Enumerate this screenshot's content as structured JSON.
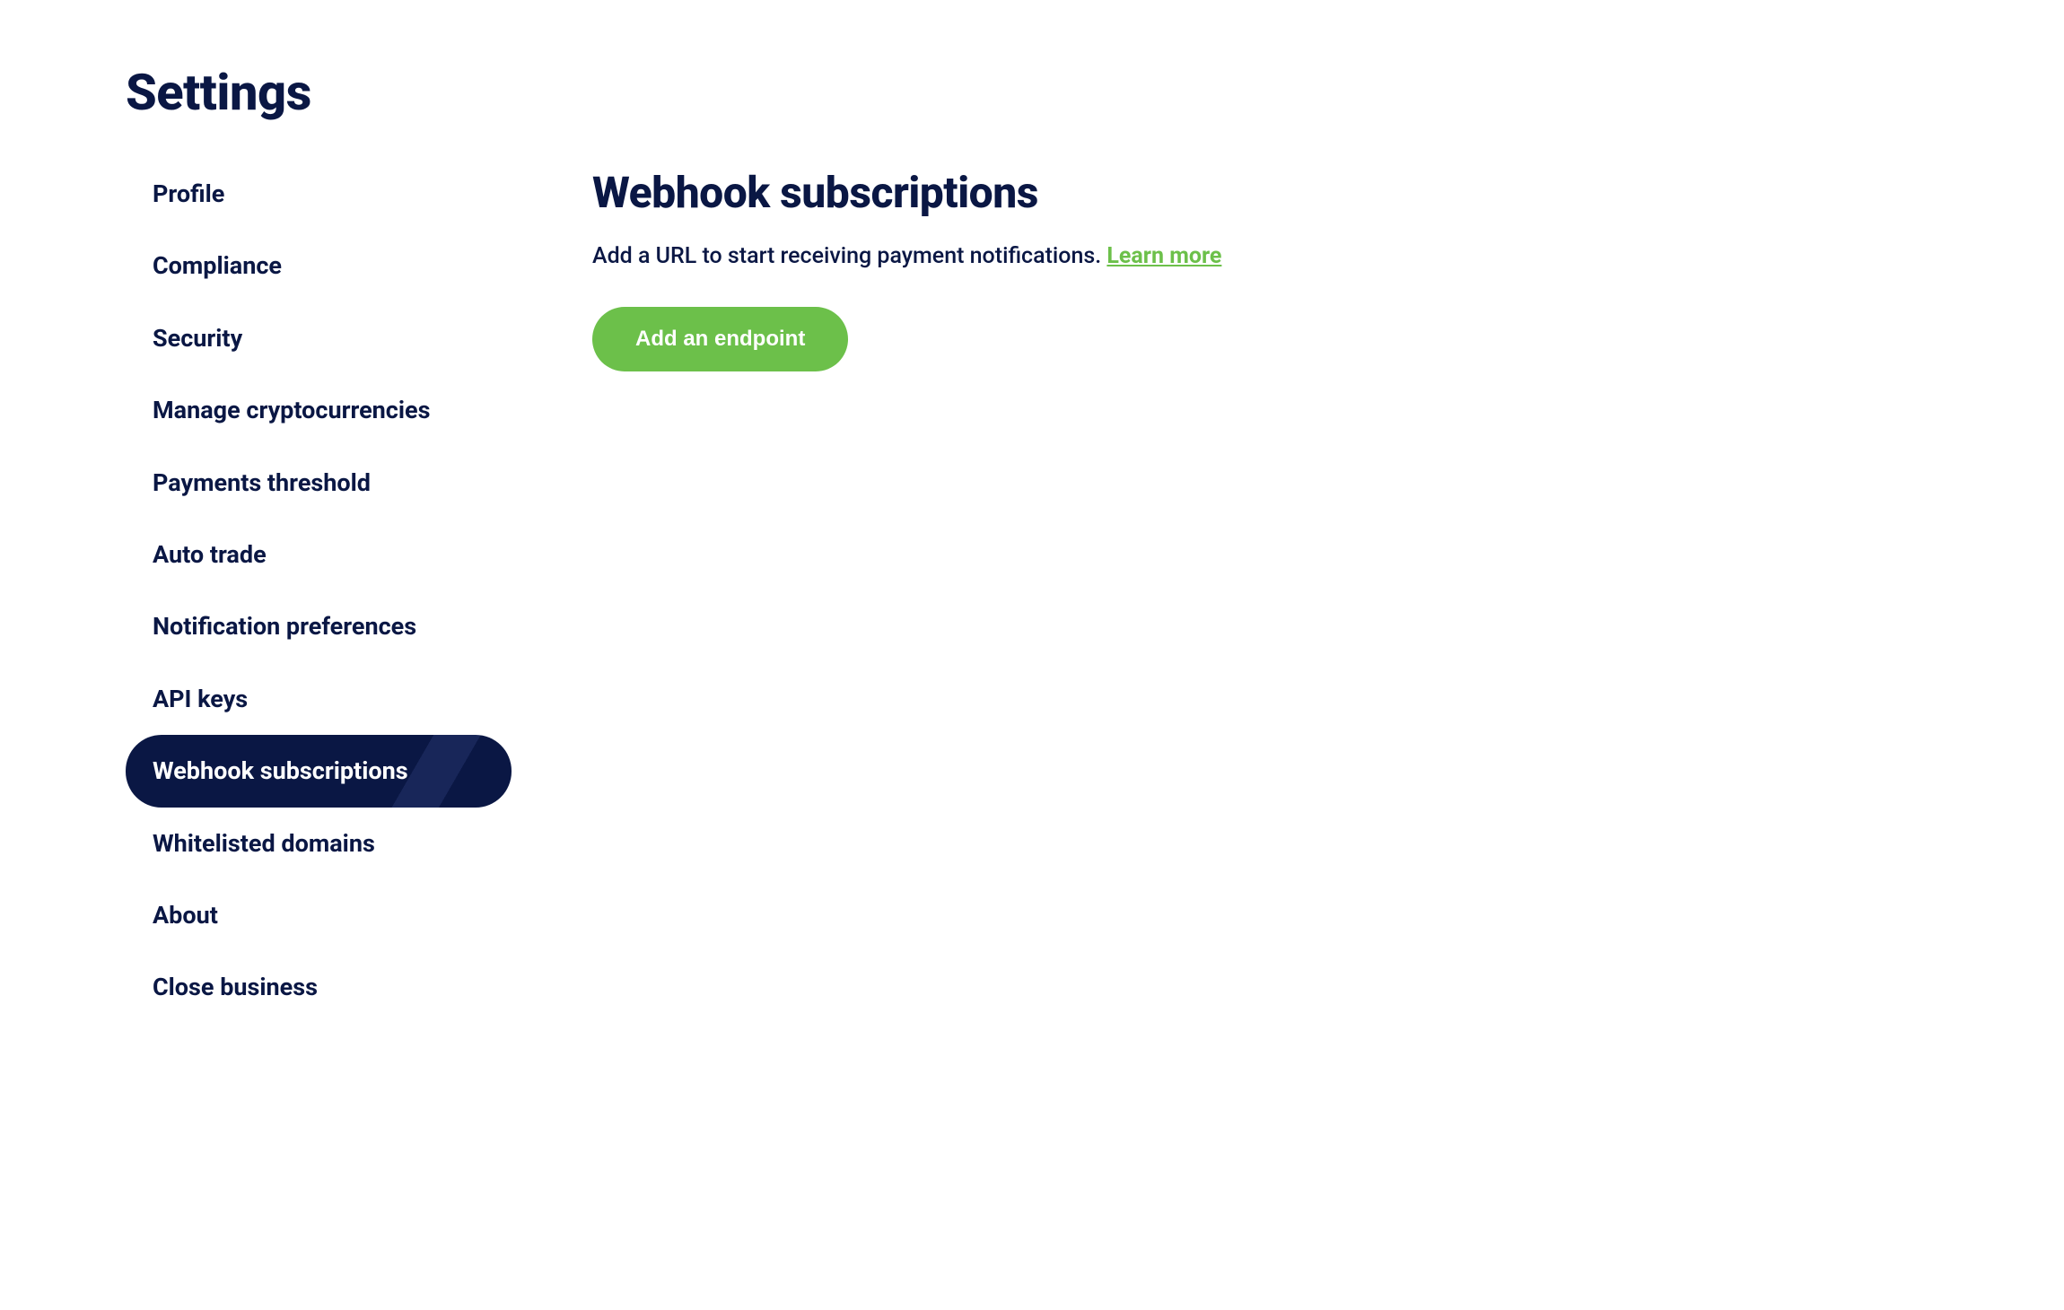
{
  "page": {
    "title": "Settings"
  },
  "sidebar": {
    "items": [
      {
        "label": "Profile",
        "active": false
      },
      {
        "label": "Compliance",
        "active": false
      },
      {
        "label": "Security",
        "active": false
      },
      {
        "label": "Manage cryptocurrencies",
        "active": false
      },
      {
        "label": "Payments threshold",
        "active": false
      },
      {
        "label": "Auto trade",
        "active": false
      },
      {
        "label": "Notification preferences",
        "active": false
      },
      {
        "label": "API keys",
        "active": false
      },
      {
        "label": "Webhook subscriptions",
        "active": true
      },
      {
        "label": "Whitelisted domains",
        "active": false
      },
      {
        "label": "About",
        "active": false
      },
      {
        "label": "Close business",
        "active": false
      }
    ]
  },
  "main": {
    "title": "Webhook subscriptions",
    "description": "Add a URL to start receiving payment notifications. ",
    "learn_more": "Learn more",
    "add_button": "Add an endpoint"
  }
}
